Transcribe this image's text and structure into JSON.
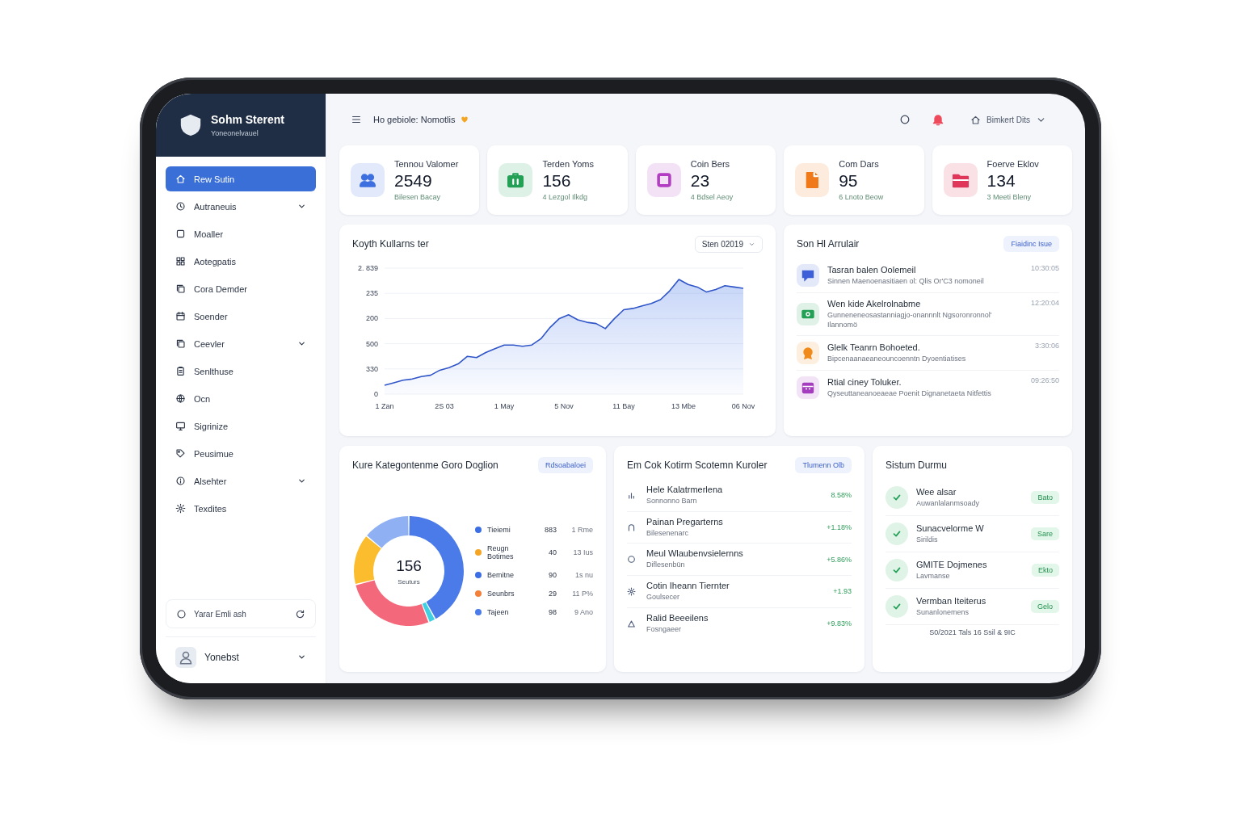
{
  "sidebar": {
    "brand": {
      "name": "Sohm Sterent",
      "subtitle": "Yoneonelvauel"
    },
    "items": [
      {
        "label": "Rew Sutin",
        "selected": true,
        "expandable": false
      },
      {
        "label": "Autraneuis",
        "selected": false,
        "expandable": true
      },
      {
        "label": "Moaller",
        "selected": false,
        "expandable": false
      },
      {
        "label": "Aotegpatis",
        "selected": false,
        "expandable": false
      },
      {
        "label": "Cora Demder",
        "selected": false,
        "expandable": false
      },
      {
        "label": "Soender",
        "selected": false,
        "expandable": false
      },
      {
        "label": "Ceevler",
        "selected": false,
        "expandable": true
      },
      {
        "label": "Senlthuse",
        "selected": false,
        "expandable": false
      },
      {
        "label": "Ocn",
        "selected": false,
        "expandable": false
      },
      {
        "label": "Sigrinize",
        "selected": false,
        "expandable": false
      },
      {
        "label": "Peusimue",
        "selected": false,
        "expandable": false
      },
      {
        "label": "Alsehter",
        "selected": false,
        "expandable": true
      },
      {
        "label": "Texdites",
        "selected": false,
        "expandable": false
      }
    ],
    "action": {
      "label": "Yarar Emli ash"
    },
    "user": {
      "name": "Yonebst"
    }
  },
  "header": {
    "greeting": "Ho gebiole: Nomotlis",
    "account": "Bimkert Dits"
  },
  "stats": [
    {
      "label": "Tennou Valomer",
      "value": "2549",
      "note": "Bilesen Bacay",
      "color": "#3d6fe0"
    },
    {
      "label": "Terden Yoms",
      "value": "156",
      "note": "4 Lezgol Ilkdg",
      "color": "#23a055"
    },
    {
      "label": "Coin Bers",
      "value": "23",
      "note": "4 Bdsel Aeoy",
      "color": "#b23cc2"
    },
    {
      "label": "Com Dars",
      "value": "95",
      "note": "6 Lnoto Beow",
      "color": "#f07a1a"
    },
    {
      "label": "Foerve Eklov",
      "value": "134",
      "note": "3 Meeti Bleny",
      "color": "#e0365a"
    }
  ],
  "usage_chart": {
    "title": "Koyth Kullarns ter",
    "range": "Sten 02019",
    "y_axis_labels": [
      "2. 839",
      "235",
      "200",
      "500",
      "330",
      "0"
    ],
    "x_axis_labels": [
      "1 Zan",
      "2S 03",
      "1 May",
      "5 Nov",
      "11 Bay",
      "13 Mbe",
      "06 Nov"
    ]
  },
  "activities": {
    "title": "Son Hl Arrulair",
    "action": "Fiaidinc Isue",
    "items": [
      {
        "title": "Tasran balen Oolemeil",
        "description": "Sinnen Maenoenasitiaen ol: Qlis Or'C3 nomoneil",
        "time": "10:30:05",
        "color": "#3d5fd8"
      },
      {
        "title": "Wen kide Akelrolnabme",
        "description": "Gunneneneosastanniagjo-onannnlt Ngsoronronnol' Ilannomö",
        "time": "12:20:04",
        "color": "#23a055"
      },
      {
        "title": "Glelk Teanrn Bohoeted.",
        "description": "Bipcenaanaeaneouncoenntn Dyoentiatises",
        "time": "3:30:06",
        "color": "#f08a1a"
      },
      {
        "title": "Rtial ciney Toluker.",
        "description": "Qyseuttaneanoeaeae Poenit Dignanetaeta Nitfettis",
        "time": "09:26:50",
        "color": "#a53cc0"
      }
    ]
  },
  "category_chart": {
    "title": "Kure Kategontenme Goro Doglion",
    "action": "Rdsoabaloei",
    "total": "156",
    "total_label": "Seuturs",
    "chart_data": {
      "type": "donut",
      "values": [
        42,
        2,
        27,
        15,
        14
      ]
    },
    "legend": [
      {
        "label": "Tieiemi",
        "count": "883",
        "share": "1 Rme",
        "color": "#3b6fe3"
      },
      {
        "label": "Reugn Botimes",
        "count": "40",
        "share": "13 Ius",
        "color": "#f5a524"
      },
      {
        "label": "Bemitne",
        "count": "90",
        "share": "1s nu",
        "color": "#3b6fe3"
      },
      {
        "label": "Seunbrs",
        "count": "29",
        "share": "11 P%",
        "color": "#f2803a"
      },
      {
        "label": "Tajeen",
        "count": "98",
        "share": "9 Ano",
        "color": "#4a7be8"
      }
    ]
  },
  "top_routes": {
    "title": "Em Cok Kotirm Scotemn Kuroler",
    "action": "Tlumenn Olb",
    "items": [
      {
        "name": "Hele Kalatrmerlena",
        "detail": "Sonnonno Barn",
        "change": "8.58%"
      },
      {
        "name": "Painan Pregarterns",
        "detail": "Bilesenenarc",
        "change": "+1.18%"
      },
      {
        "name": "Meul Wlaubenvsielernns",
        "detail": "Diflesenbün",
        "change": "+5.86%"
      },
      {
        "name": "Cotin Iheann Tiernter",
        "detail": "Goulsecer",
        "change": "+1.93"
      },
      {
        "name": "Ralid Beeeilens",
        "detail": "Fosngaeer",
        "change": "+9.83%"
      }
    ]
  },
  "system_status": {
    "title": "Sistum Durmu",
    "items": [
      {
        "name": "Wee alsar",
        "detail": "Auwanlalanmsoady",
        "badge": "Bato"
      },
      {
        "name": "Sunacvelorme W",
        "detail": "Sirildis",
        "badge": "Sare"
      },
      {
        "name": "GMITE Dojmenes",
        "detail": "Lavmanse",
        "badge": "Ekto"
      },
      {
        "name": "Vermban Iteiterus",
        "detail": "Sunanlonemens",
        "badge": "Gelo"
      }
    ],
    "footer": "S0/2021 Tals 16 Ssil & 9IC"
  }
}
